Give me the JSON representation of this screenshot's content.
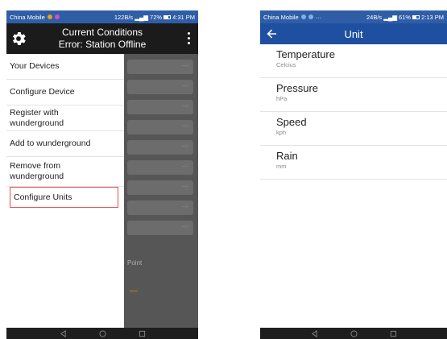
{
  "left_screen": {
    "status": {
      "carrier": "China Mobile",
      "speed": "122B/s",
      "battery": "72%",
      "time": "4:31 PM"
    },
    "title_line1": "Current Conditions",
    "title_line2": "Error: Station Offline",
    "row_placeholder": "--:-",
    "drawer_items": [
      {
        "label": "Your Devices"
      },
      {
        "label": "Configure Device"
      },
      {
        "label": "Register with\nwunderground"
      },
      {
        "label": "Add to wunderground"
      },
      {
        "label": "Remove from\nwunderground"
      },
      {
        "label": "Configure Units"
      }
    ],
    "partial_label": "Point"
  },
  "right_screen": {
    "status": {
      "carrier": "China Mobile",
      "speed": "24B/s",
      "battery": "61%",
      "time": "2:13 PM"
    },
    "title": "Unit",
    "units": [
      {
        "name": "Temperature",
        "value": "Celcius"
      },
      {
        "name": "Pressure",
        "value": "hPa"
      },
      {
        "name": "Speed",
        "value": "kph"
      },
      {
        "name": "Rain",
        "value": "mm"
      }
    ]
  },
  "colors": {
    "status_bar": "#2f5ea7",
    "app_bar_left": "#1b1b1b",
    "app_bar_right": "#1f4fa0",
    "highlight": "#e05252"
  }
}
